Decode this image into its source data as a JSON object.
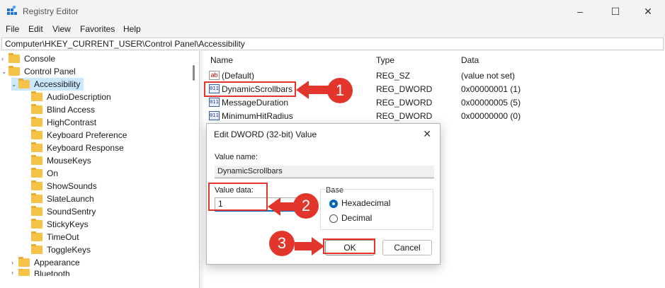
{
  "window": {
    "title": "Registry Editor",
    "minimize": "–",
    "maximize": "☐",
    "close": "✕"
  },
  "menu": [
    "File",
    "Edit",
    "View",
    "Favorites",
    "Help"
  ],
  "address": "Computer\\HKEY_CURRENT_USER\\Control Panel\\Accessibility",
  "tree": {
    "items": [
      {
        "label": "Console",
        "chev": "›"
      },
      {
        "label": "Control Panel",
        "chev": "⌄"
      },
      {
        "label": "Accessibility",
        "chev": "⌄"
      },
      {
        "label": "AudioDescription"
      },
      {
        "label": "Blind Access"
      },
      {
        "label": "HighContrast"
      },
      {
        "label": "Keyboard Preference"
      },
      {
        "label": "Keyboard Response"
      },
      {
        "label": "MouseKeys"
      },
      {
        "label": "On"
      },
      {
        "label": "ShowSounds"
      },
      {
        "label": "SlateLaunch"
      },
      {
        "label": "SoundSentry"
      },
      {
        "label": "StickyKeys"
      },
      {
        "label": "TimeOut"
      },
      {
        "label": "ToggleKeys"
      },
      {
        "label": "Appearance",
        "chev": "›"
      },
      {
        "label": "Bluetooth",
        "chev": "›"
      }
    ]
  },
  "list": {
    "headers": {
      "name": "Name",
      "type": "Type",
      "data": "Data"
    },
    "rows": [
      {
        "icon": "ab",
        "name": "(Default)",
        "type": "REG_SZ",
        "data": "(value not set)"
      },
      {
        "icon": "bin",
        "name": "DynamicScrollbars",
        "type": "REG_DWORD",
        "data": "0x00000001 (1)"
      },
      {
        "icon": "bin",
        "name": "MessageDuration",
        "type": "REG_DWORD",
        "data": "0x00000005 (5)"
      },
      {
        "icon": "bin",
        "name": "MinimumHitRadius",
        "type": "REG_DWORD",
        "data": "0x00000000 (0)"
      }
    ],
    "bin_icon_text": "011",
    "ab_icon_text": "ab"
  },
  "dialog": {
    "title": "Edit DWORD (32-bit) Value",
    "close": "✕",
    "value_name_label": "Value name:",
    "value_name": "DynamicScrollbars",
    "value_data_label": "Value data:",
    "value_data": "1",
    "base_label": "Base",
    "hex_label": "Hexadecimal",
    "dec_label": "Decimal",
    "ok_label": "OK",
    "cancel_label": "Cancel"
  },
  "badges": {
    "one": "1",
    "two": "2",
    "three": "3"
  },
  "colors": {
    "annotation": "#e2352b",
    "selection": "#cce8ff",
    "accent": "#0067c0"
  }
}
